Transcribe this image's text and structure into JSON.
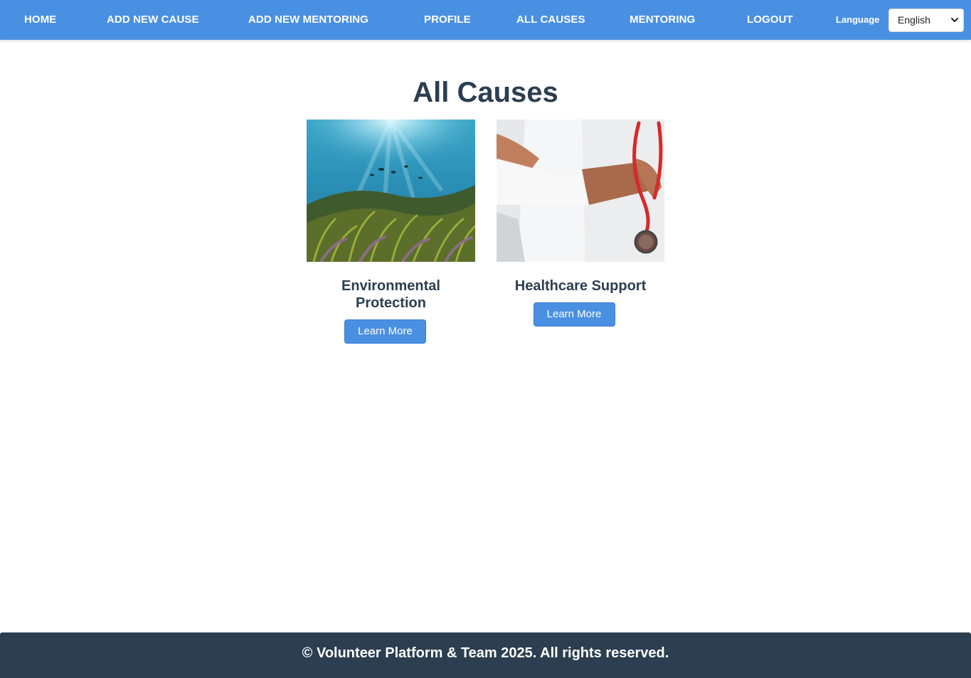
{
  "nav": {
    "items": [
      {
        "label": "HOME"
      },
      {
        "label": "ADD NEW CAUSE"
      },
      {
        "label": "ADD NEW MENTORING"
      },
      {
        "label": "PROFILE"
      },
      {
        "label": "ALL CAUSES"
      },
      {
        "label": "MENTORING"
      },
      {
        "label": "LOGOUT"
      }
    ],
    "language_label": "Language",
    "language_selected": "English"
  },
  "main": {
    "title": "All Causes",
    "causes": [
      {
        "title": "Environmental Protection",
        "button_label": "Learn More",
        "image_icon": "underwater-seagrass-image"
      },
      {
        "title": "Healthcare Support",
        "button_label": "Learn More",
        "image_icon": "doctor-stethoscope-image"
      }
    ]
  },
  "footer": {
    "text": "© Volunteer Platform & Team 2025. All rights reserved."
  },
  "colors": {
    "nav_bg": "#4a90e2",
    "button_bg": "#4a90e2",
    "footer_bg": "#2c3e50",
    "title_text": "#2c3e50"
  }
}
